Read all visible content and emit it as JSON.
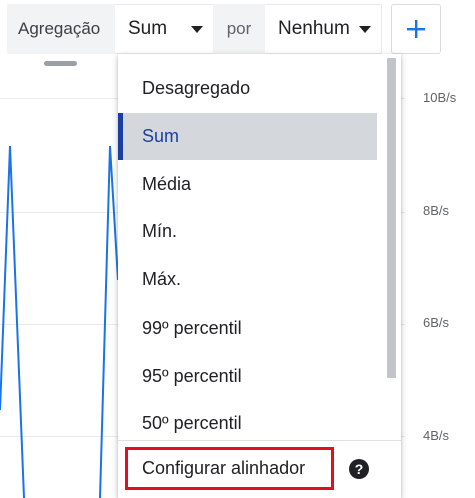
{
  "toolbar": {
    "aggregation_label": "Agregação",
    "aggregation_value": "Sum",
    "by_label": "por",
    "group_by_value": "Nenhum",
    "add_icon": "plus-icon"
  },
  "chart": {
    "y_ticks": [
      "10B/s",
      "8B/s",
      "6B/s",
      "4B/s"
    ],
    "line_color": "#1a73e8"
  },
  "menu": {
    "items": [
      {
        "label": "Desagregado"
      },
      {
        "label": "Sum",
        "selected": true
      },
      {
        "label": "Média"
      },
      {
        "label": "Mín."
      },
      {
        "label": "Máx."
      },
      {
        "label": "99º percentil"
      },
      {
        "label": "95º percentil"
      },
      {
        "label": "50º percentil"
      }
    ],
    "config_label": "Configurar alinhador",
    "help_icon": "help-circle-icon",
    "accent": "#1a3fa0",
    "highlight_border": "#e0101f"
  }
}
